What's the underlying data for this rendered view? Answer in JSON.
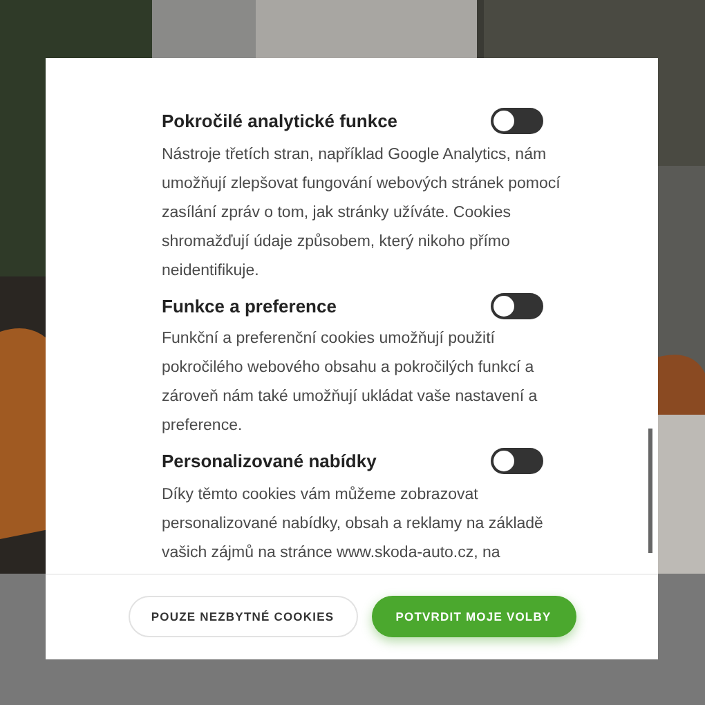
{
  "sections": [
    {
      "title": "Pokročilé analytické funkce",
      "on": false,
      "description": "Nástroje třetích stran, například Google Analytics, nám umožňují zlepšovat fungování webových stránek pomocí zasílání zpráv o tom, jak stránky užíváte. Cookies shromažďují údaje způsobem, který nikoho přímo neidentifikuje."
    },
    {
      "title": "Funkce a preference",
      "on": false,
      "description": "Funkční a preferenční cookies umožňují použití pokročilého webového obsahu a pokročilých funkcí a zároveň nám také umožňují ukládat vaše nastavení a preference."
    },
    {
      "title": "Personalizované nabídky",
      "on": false,
      "description": "Díky těmto cookies vám můžeme zobrazovat personalizované nabídky, obsah a reklamy na základě vašich zájmů na stránce www.skoda-auto.cz, na"
    }
  ],
  "buttons": [
    {
      "label": "POUZE NEZBYTNÉ COOKIES",
      "kind": "secondary"
    },
    {
      "label": "POTVRDIT MOJE VOLBY",
      "kind": "primary"
    }
  ]
}
